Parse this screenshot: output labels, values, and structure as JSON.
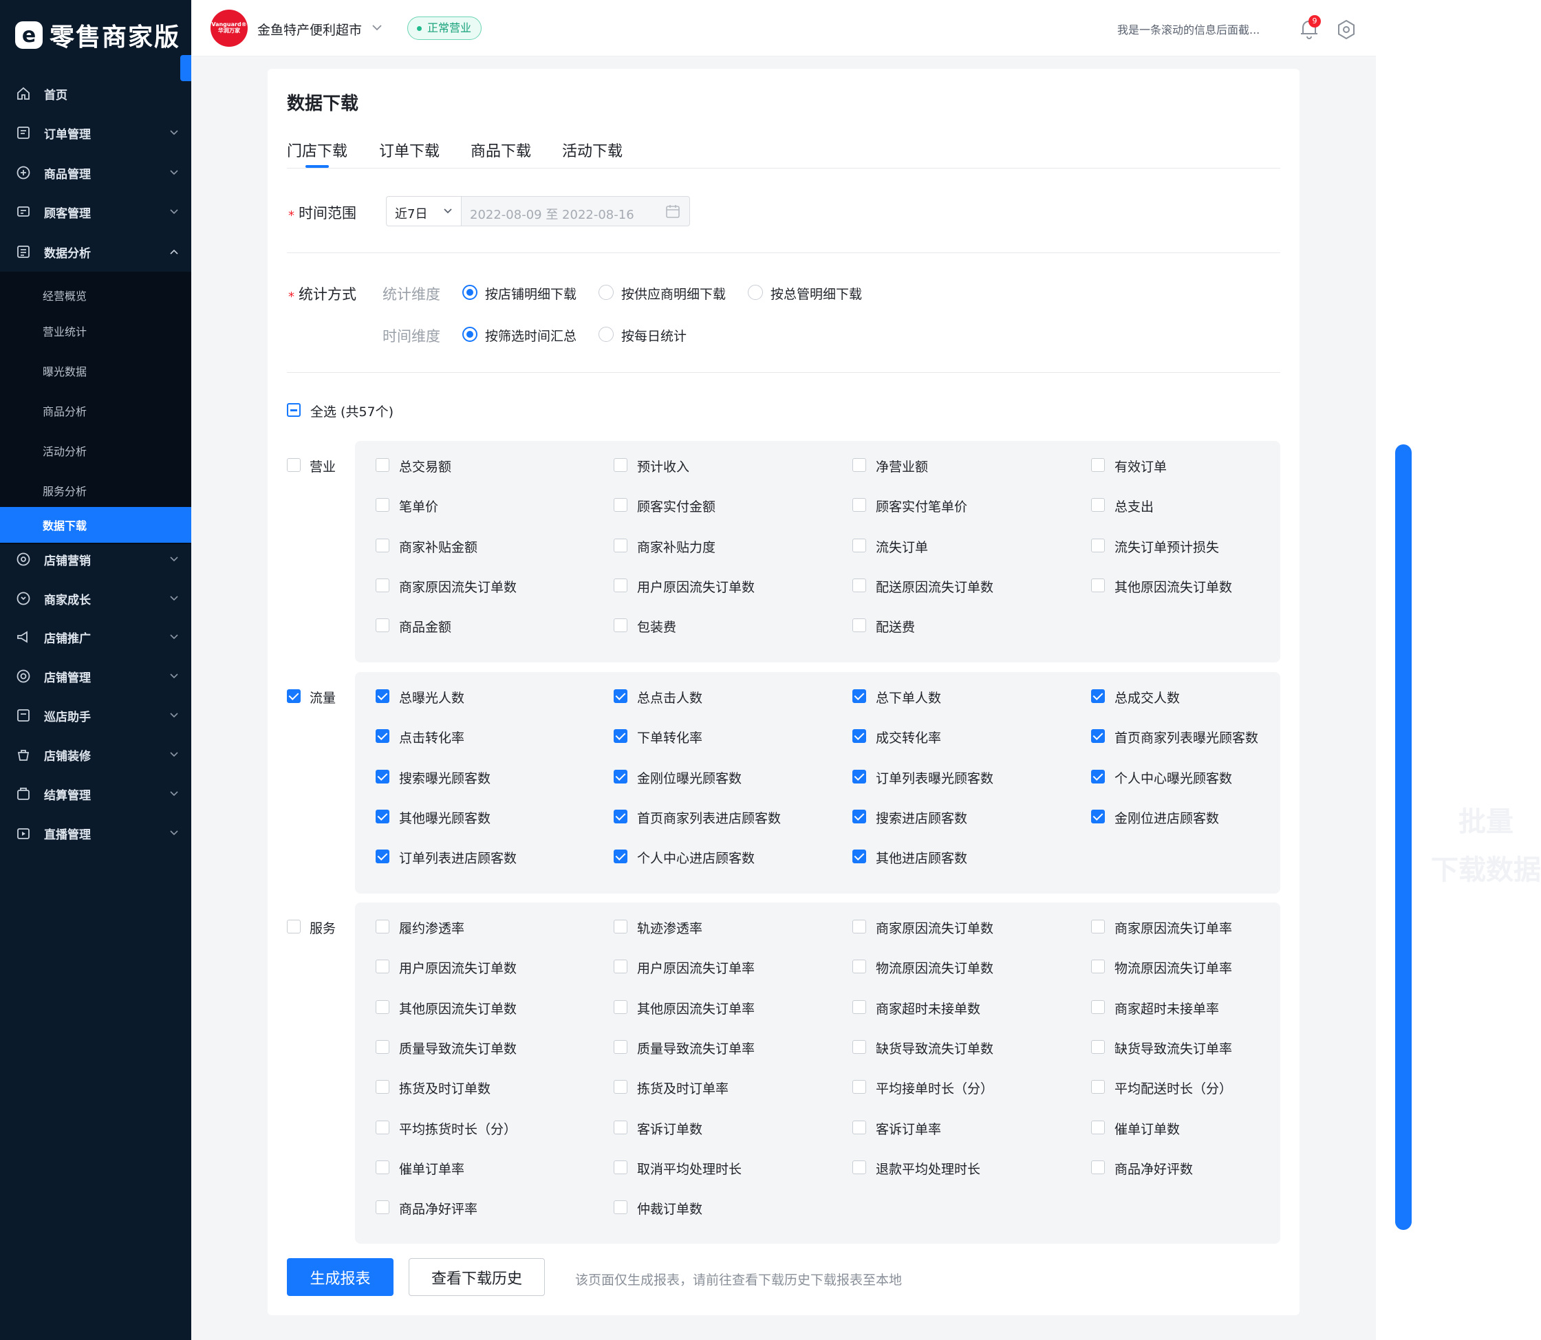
{
  "brand": {
    "logo_glyph": "e",
    "name": "零售商家版"
  },
  "sidebar": {
    "items": [
      {
        "label": "首页",
        "icon": "home-icon",
        "has_arrow": false
      },
      {
        "label": "订单管理",
        "icon": "order-icon",
        "has_arrow": true
      },
      {
        "label": "商品管理",
        "icon": "product-icon",
        "has_arrow": true
      },
      {
        "label": "顾客管理",
        "icon": "customer-icon",
        "has_arrow": true
      },
      {
        "label": "数据分析",
        "icon": "data-analysis-icon",
        "has_arrow": true,
        "expanded": true
      }
    ],
    "sub_items": [
      {
        "label": "经营概览",
        "active": false
      },
      {
        "label": "营业统计",
        "active": false
      },
      {
        "label": "曝光数据",
        "active": false
      },
      {
        "label": "商品分析",
        "active": false
      },
      {
        "label": "活动分析",
        "active": false
      },
      {
        "label": "服务分析",
        "active": false
      },
      {
        "label": "数据下载",
        "active": true
      }
    ],
    "items_after": [
      {
        "label": "店铺营销",
        "icon": "marketing-icon"
      },
      {
        "label": "商家成长",
        "icon": "growth-icon"
      },
      {
        "label": "店铺推广",
        "icon": "promotion-icon"
      },
      {
        "label": "店铺管理",
        "icon": "store-settings-icon"
      },
      {
        "label": "巡店助手",
        "icon": "patrol-icon"
      },
      {
        "label": "店铺装修",
        "icon": "decoration-icon"
      },
      {
        "label": "结算管理",
        "icon": "settlement-icon"
      },
      {
        "label": "直播管理",
        "icon": "live-icon"
      }
    ]
  },
  "header": {
    "store_logo_text": "Vanguard® 华润万家",
    "store_name": "金鱼特产便利超市",
    "status": "正常营业",
    "marquee": "我是一条滚动的信息后面截...",
    "notification_count": "9"
  },
  "page": {
    "title": "数据下载",
    "tabs": [
      {
        "label": "门店下载",
        "active": true
      },
      {
        "label": "订单下载",
        "active": false
      },
      {
        "label": "商品下载",
        "active": false
      },
      {
        "label": "活动下载",
        "active": false
      }
    ],
    "time_range": {
      "label": "时间范围",
      "select_value": "近7日",
      "date_range": "2022-08-09 至 2022-08-16"
    },
    "stat_method": {
      "label": "统计方式",
      "dimension_label": "统计维度",
      "dimension_options": [
        {
          "label": "按店铺明细下载",
          "checked": true
        },
        {
          "label": "按供应商明细下载",
          "checked": false
        },
        {
          "label": "按总管明细下载",
          "checked": false
        }
      ],
      "time_label": "时间维度",
      "time_options": [
        {
          "label": "按筛选时间汇总",
          "checked": true
        },
        {
          "label": "按每日统计",
          "checked": false
        }
      ]
    },
    "select_all": {
      "label": "全选 (共57个)",
      "state": "indeterminate"
    },
    "groups": [
      {
        "name": "营业",
        "checked": false,
        "items": [
          "总交易额",
          "预计收入",
          "净营业额",
          "有效订单",
          "笔单价",
          "顾客实付金额",
          "顾客实付笔单价",
          "总支出",
          "商家补贴金额",
          "商家补贴力度",
          "流失订单",
          "流失订单预计损失",
          "商家原因流失订单数",
          "用户原因流失订单数",
          "配送原因流失订单数",
          "其他原因流失订单数",
          "商品金额",
          "包装费",
          "配送费"
        ]
      },
      {
        "name": "流量",
        "checked": true,
        "items": [
          "总曝光人数",
          "总点击人数",
          "总下单人数",
          "总成交人数",
          "点击转化率",
          "下单转化率",
          "成交转化率",
          "首页商家列表曝光顾客数",
          "搜索曝光顾客数",
          "金刚位曝光顾客数",
          "订单列表曝光顾客数",
          "个人中心曝光顾客数",
          "其他曝光顾客数",
          "首页商家列表进店顾客数",
          "搜索进店顾客数",
          "金刚位进店顾客数",
          "订单列表进店顾客数",
          "个人中心进店顾客数",
          "其他进店顾客数"
        ]
      },
      {
        "name": "服务",
        "checked": false,
        "items": [
          "履约渗透率",
          "轨迹渗透率",
          "商家原因流失订单数",
          "商家原因流失订单率",
          "用户原因流失订单数",
          "用户原因流失订单率",
          "物流原因流失订单数",
          "物流原因流失订单率",
          "其他原因流失订单数",
          "其他原因流失订单率",
          "商家超时未接单数",
          "商家超时未接单率",
          "质量导致流失订单数",
          "质量导致流失订单率",
          "缺货导致流失订单数",
          "缺货导致流失订单率",
          "拣货及时订单数",
          "拣货及时订单率",
          "平均接单时长（分）",
          "平均配送时长（分）",
          "平均拣货时长（分）",
          "客诉订单数",
          "客诉订单率",
          "催单订单数",
          "催单订单率",
          "取消平均处理时长",
          "退款平均处理时长",
          "商品净好评数",
          "商品净好评率",
          "仲裁订单数"
        ]
      }
    ],
    "buttons": {
      "generate": "生成报表",
      "history": "查看下载历史"
    },
    "hint": "该页面仅生成报表，请前往查看下载历史下载报表至本地"
  },
  "watermark": [
    "批量",
    "下载数据"
  ],
  "colors": {
    "accent": "#1677ff",
    "sidebar_bg": "#0b1a2b",
    "status_green": "#17a27a",
    "required_red": "#f5222d"
  }
}
